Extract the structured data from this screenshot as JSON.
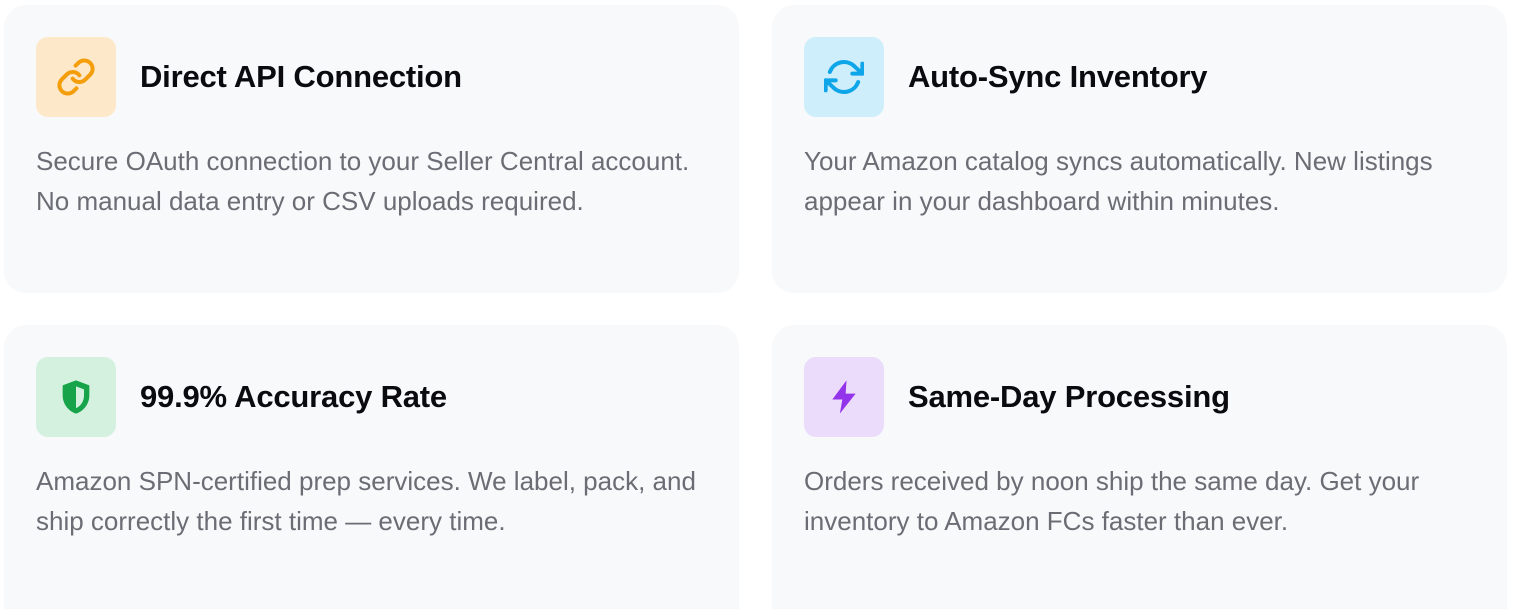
{
  "features": [
    {
      "title": "Direct API Connection",
      "description": "Secure OAuth connection to your Seller Central account. No manual data entry or CSV uploads required.",
      "icon": "link-icon",
      "icon_color": "#f59e0b",
      "icon_bg": "#fde8c9"
    },
    {
      "title": "Auto-Sync Inventory",
      "description": "Your Amazon catalog syncs automatically. New listings appear in your dashboard within minutes.",
      "icon": "sync-icon",
      "icon_color": "#0ea5e9",
      "icon_bg": "#cdeefa"
    },
    {
      "title": "99.9% Accuracy Rate",
      "description": "Amazon SPN-certified prep services. We label, pack, and ship correctly the first time — every time.",
      "icon": "shield-icon",
      "icon_color": "#16a34a",
      "icon_bg": "#d3f1de"
    },
    {
      "title": "Same-Day Processing",
      "description": "Orders received by noon ship the same day. Get your inventory to Amazon FCs faster than ever.",
      "icon": "lightning-icon",
      "icon_color": "#9333ea",
      "icon_bg": "#ecdcfb"
    }
  ]
}
